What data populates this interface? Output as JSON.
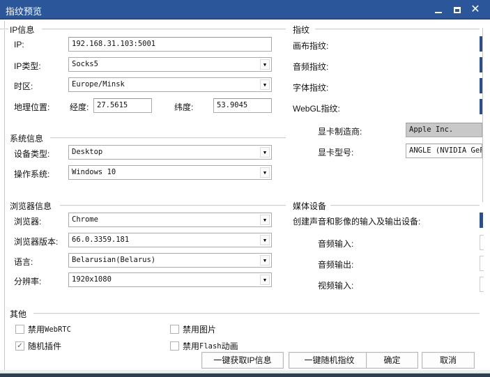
{
  "window": {
    "title": "指纹预览",
    "controls": {
      "minimize": "—",
      "maximize": "□",
      "close": "✕"
    },
    "accent_color": "#2b579a"
  },
  "ip_info": {
    "title": "IP信息",
    "ip_label": "IP:",
    "ip_value": "192.168.31.103:5001",
    "ip_type_label": "IP类型:",
    "ip_type_value": "Socks5",
    "timezone_label": "时区:",
    "timezone_value": "Europe/Minsk",
    "geo_label": "地理位置:",
    "longitude_label": "经度:",
    "longitude_value": "27.5615",
    "latitude_label": "纬度:",
    "latitude_value": "53.9045"
  },
  "system_info": {
    "title": "系统信息",
    "device_type_label": "设备类型:",
    "device_type_value": "Desktop",
    "os_label": "操作系统:",
    "os_value": "Windows 10"
  },
  "browser_info": {
    "title": "浏览器信息",
    "browser_label": "浏览器:",
    "browser_value": "Chrome",
    "version_label": "浏览器版本:",
    "version_value": "66.0.3359.181",
    "language_label": "语言:",
    "language_value": "Belarusian(Belarus)",
    "resolution_label": "分辨率:",
    "resolution_value": "1920x1080"
  },
  "other": {
    "title": "其他",
    "checkboxes": [
      {
        "label_cn": "禁用",
        "label_en": "WebRTC",
        "checked": false
      },
      {
        "label_cn": "随机插件",
        "label_en": "",
        "checked": true
      },
      {
        "label_cn": "禁用图片",
        "label_en": "",
        "checked": false
      },
      {
        "label_cn": "禁用",
        "label_en": "Flash",
        "label_cn2": "动画",
        "checked": false
      }
    ]
  },
  "fingerprint": {
    "title": "指纹",
    "canvas_label": "画布指纹:",
    "audio_label": "音频指纹:",
    "font_label": "字体指纹:",
    "webgl_label": "WebGL指纹:",
    "gpu_vendor_label": "显卡制造商:",
    "gpu_vendor_value": "Apple Inc.",
    "gpu_model_label": "显卡型号:",
    "gpu_model_value": "ANGLE (NVIDIA GeFo"
  },
  "media": {
    "title": "媒体设备",
    "create_label": "创建声音和影像的输入及输出设备:",
    "audio_in_label": "音频输入:",
    "audio_out_label": "音频输出:",
    "video_in_label": "视频输入:"
  },
  "buttons": {
    "get_ip": "一键获取IP信息",
    "random_fp": "一键随机指纹",
    "ok": "确定",
    "cancel": "取消"
  }
}
